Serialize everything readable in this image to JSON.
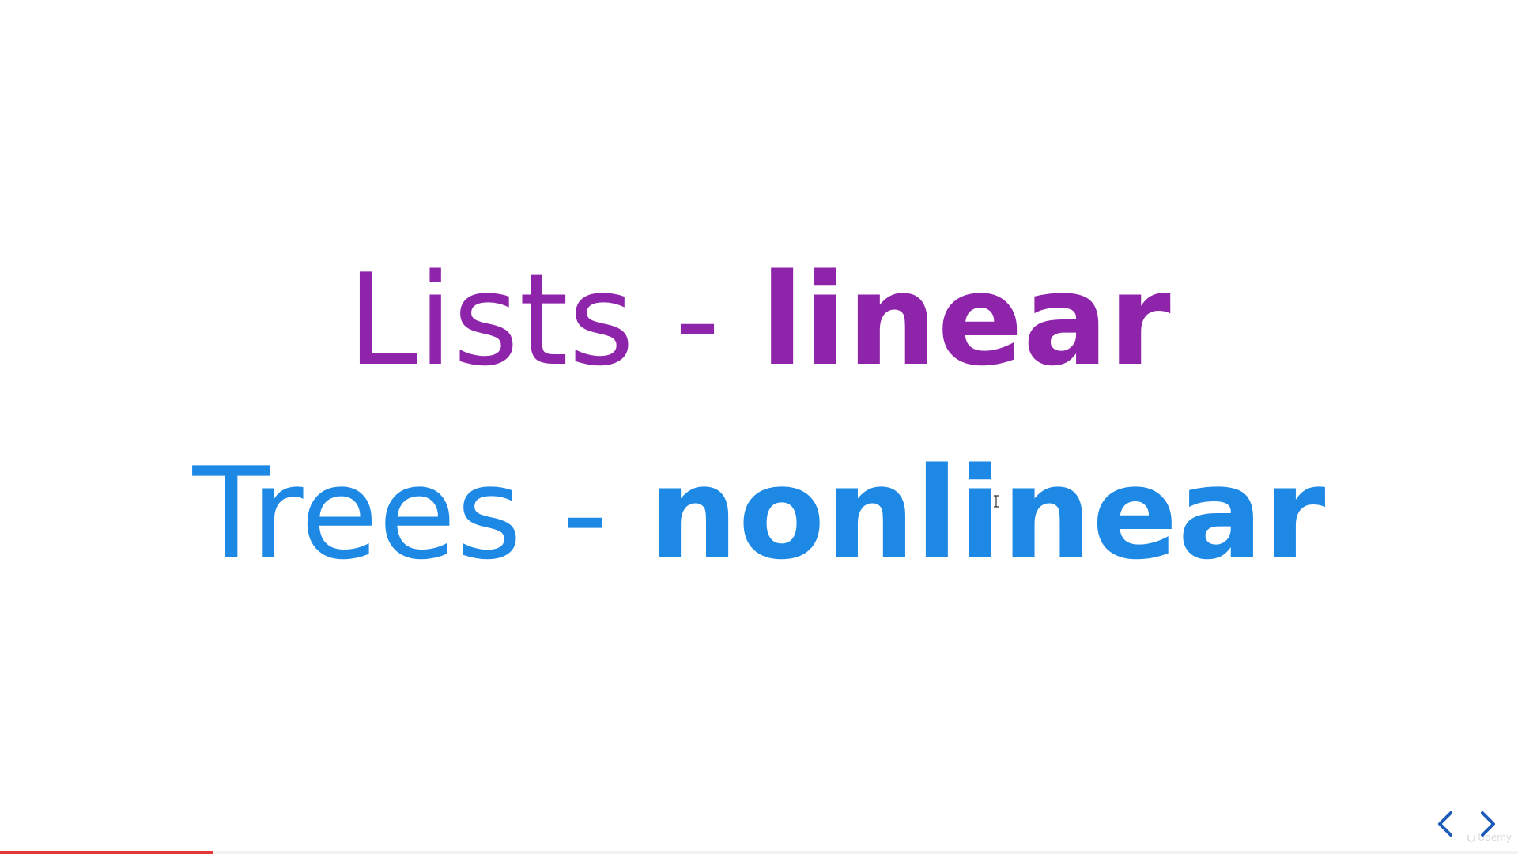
{
  "slide": {
    "line1": {
      "term": "Lists",
      "separator": " - ",
      "kind": "linear"
    },
    "line2": {
      "term": "Trees",
      "separator": " - ",
      "kind": "nonlinear"
    }
  },
  "navigation": {
    "prev_icon": "chevron-left",
    "next_icon": "chevron-right"
  },
  "watermark": {
    "text": "Udemy",
    "icon": "udemy-logo"
  },
  "progress": {
    "fraction": 0.14
  },
  "colors": {
    "background": "#ffffff",
    "lists": "#8e24aa",
    "trees": "#1e88e5",
    "nav": "#1e5bb8",
    "progress": "#e53935",
    "watermark": "#9a9a9a"
  }
}
